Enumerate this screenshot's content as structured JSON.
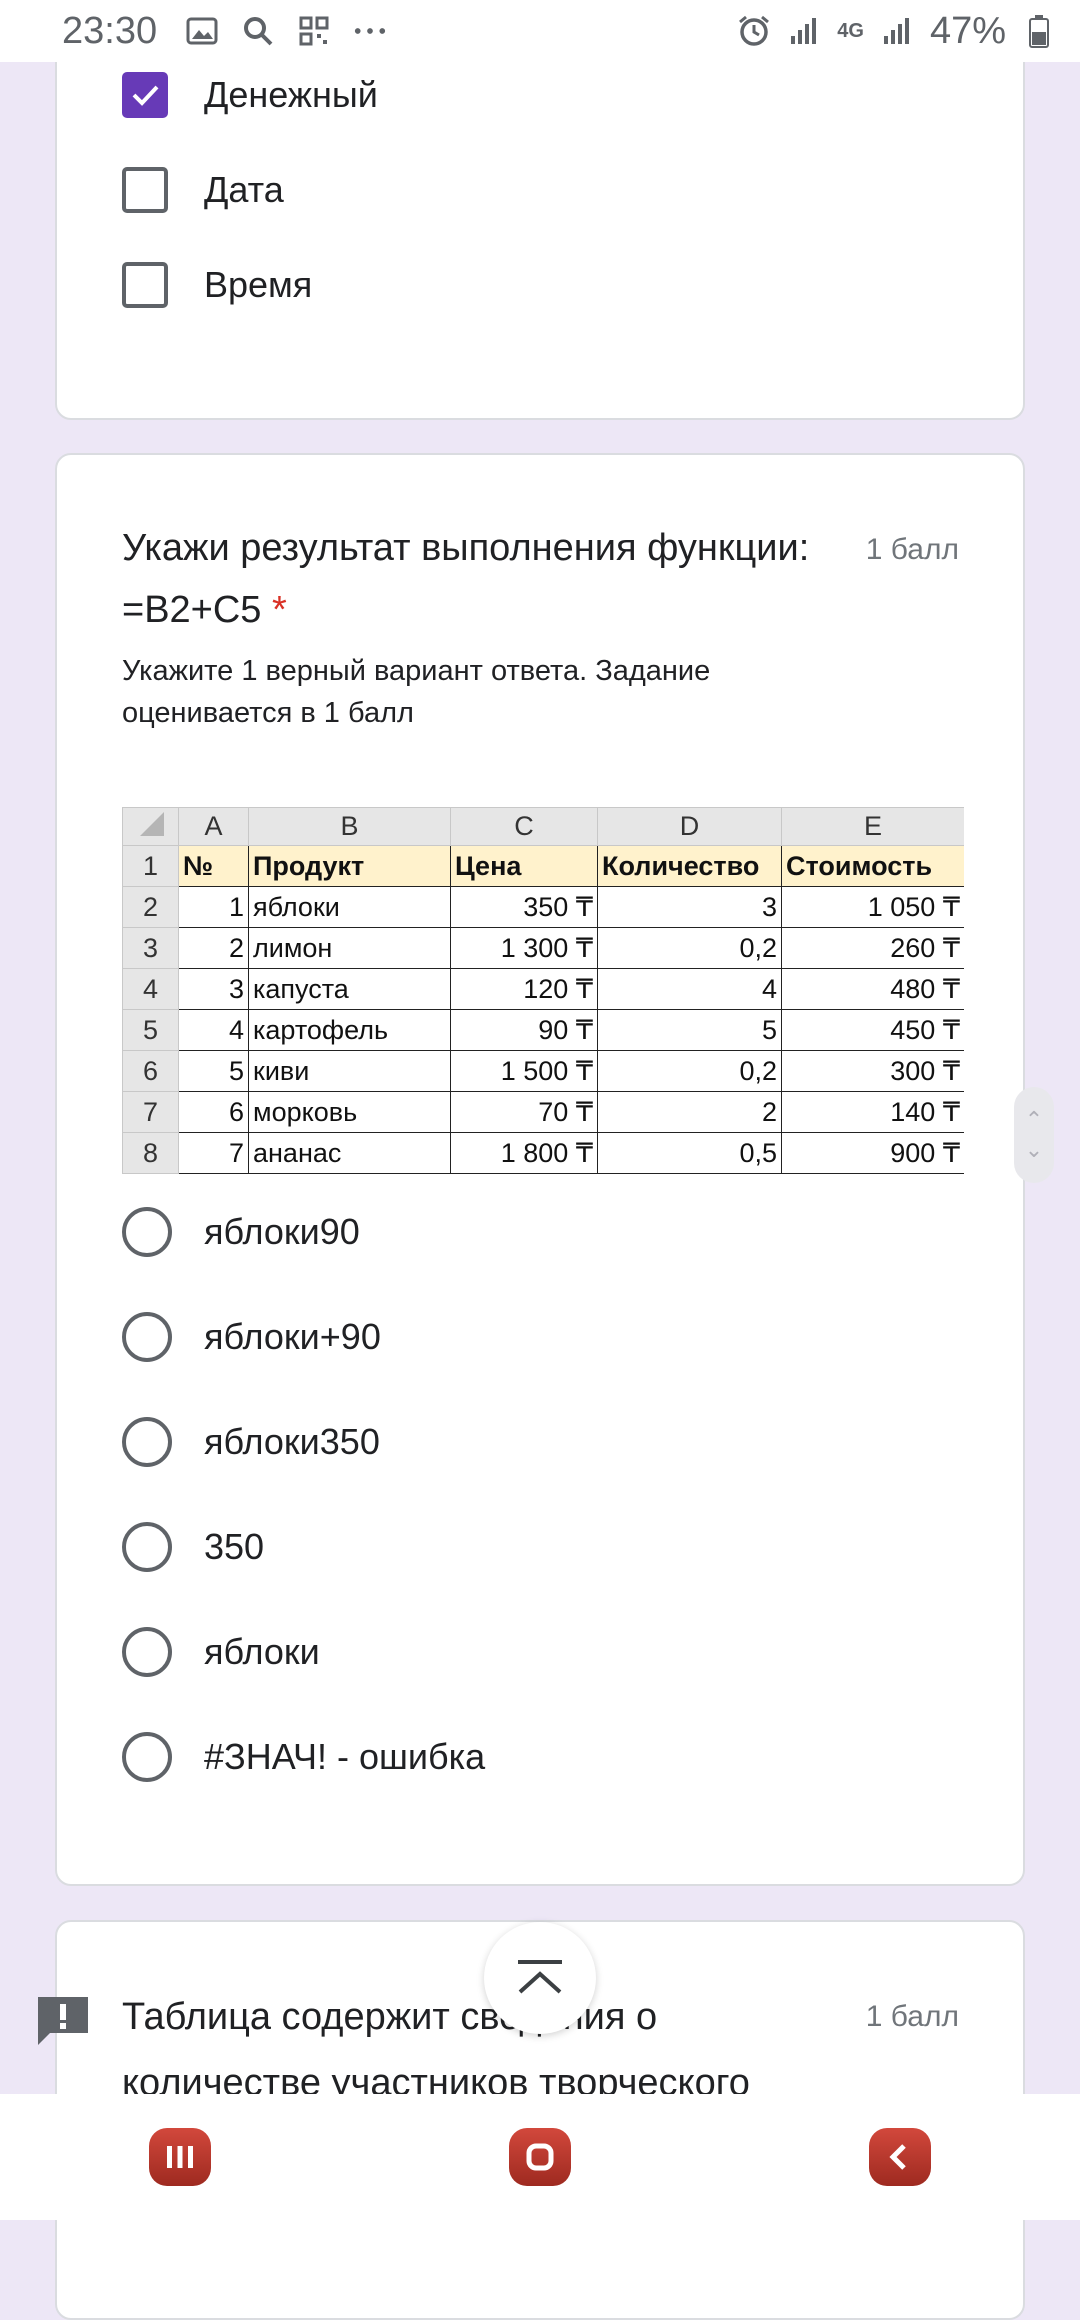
{
  "status_bar": {
    "time": "23:30",
    "network": "4G",
    "battery": "47%",
    "left_icons": [
      "image-icon",
      "search-icon",
      "qr-icon",
      "more-icon"
    ],
    "right_icons": [
      "alarm-icon",
      "signal-icon",
      "signal-icon",
      "battery-icon"
    ]
  },
  "question_prev": {
    "options": [
      {
        "label": "Денежный",
        "checked": true
      },
      {
        "label": "Дата",
        "checked": false
      },
      {
        "label": "Время",
        "checked": false
      }
    ]
  },
  "question": {
    "title": "Укажи результат выполнения функции: =B2+C5",
    "required_mark": "*",
    "points": "1 балл",
    "description": "Укажите 1 верный вариант ответа. Задание оценивается в 1 балл",
    "sheet": {
      "columns": [
        "A",
        "B",
        "C",
        "D",
        "E"
      ],
      "row_numbers": [
        "1",
        "2",
        "3",
        "4",
        "5",
        "6",
        "7",
        "8"
      ],
      "header": [
        "№",
        "Продукт",
        "Цена",
        "Количество",
        "Стоимость"
      ],
      "rows": [
        [
          "1",
          "яблоки",
          "350 ₸",
          "3",
          "1 050 ₸"
        ],
        [
          "2",
          "лимон",
          "1 300 ₸",
          "0,2",
          "260 ₸"
        ],
        [
          "3",
          "капуста",
          "120 ₸",
          "4",
          "480 ₸"
        ],
        [
          "4",
          "картофель",
          "90 ₸",
          "5",
          "450 ₸"
        ],
        [
          "5",
          "киви",
          "1 500 ₸",
          "0,2",
          "300 ₸"
        ],
        [
          "6",
          "морковь",
          "70 ₸",
          "2",
          "140 ₸"
        ],
        [
          "7",
          "ананас",
          "1 800 ₸",
          "0,5",
          "900 ₸"
        ]
      ]
    },
    "options": [
      {
        "label": "яблоки90"
      },
      {
        "label": "яблоки+90"
      },
      {
        "label": "яблоки350"
      },
      {
        "label": "350"
      },
      {
        "label": "яблоки"
      },
      {
        "label": "#ЗНАЧ! - ошибка"
      }
    ]
  },
  "question_next": {
    "title": "Таблица содержит сведения о количестве участников творческого",
    "points": "1 балл"
  },
  "colors": {
    "accent": "#673ab7",
    "background": "#ede7f6",
    "required": "#d93025",
    "sheet_header": "#fff2cc"
  }
}
